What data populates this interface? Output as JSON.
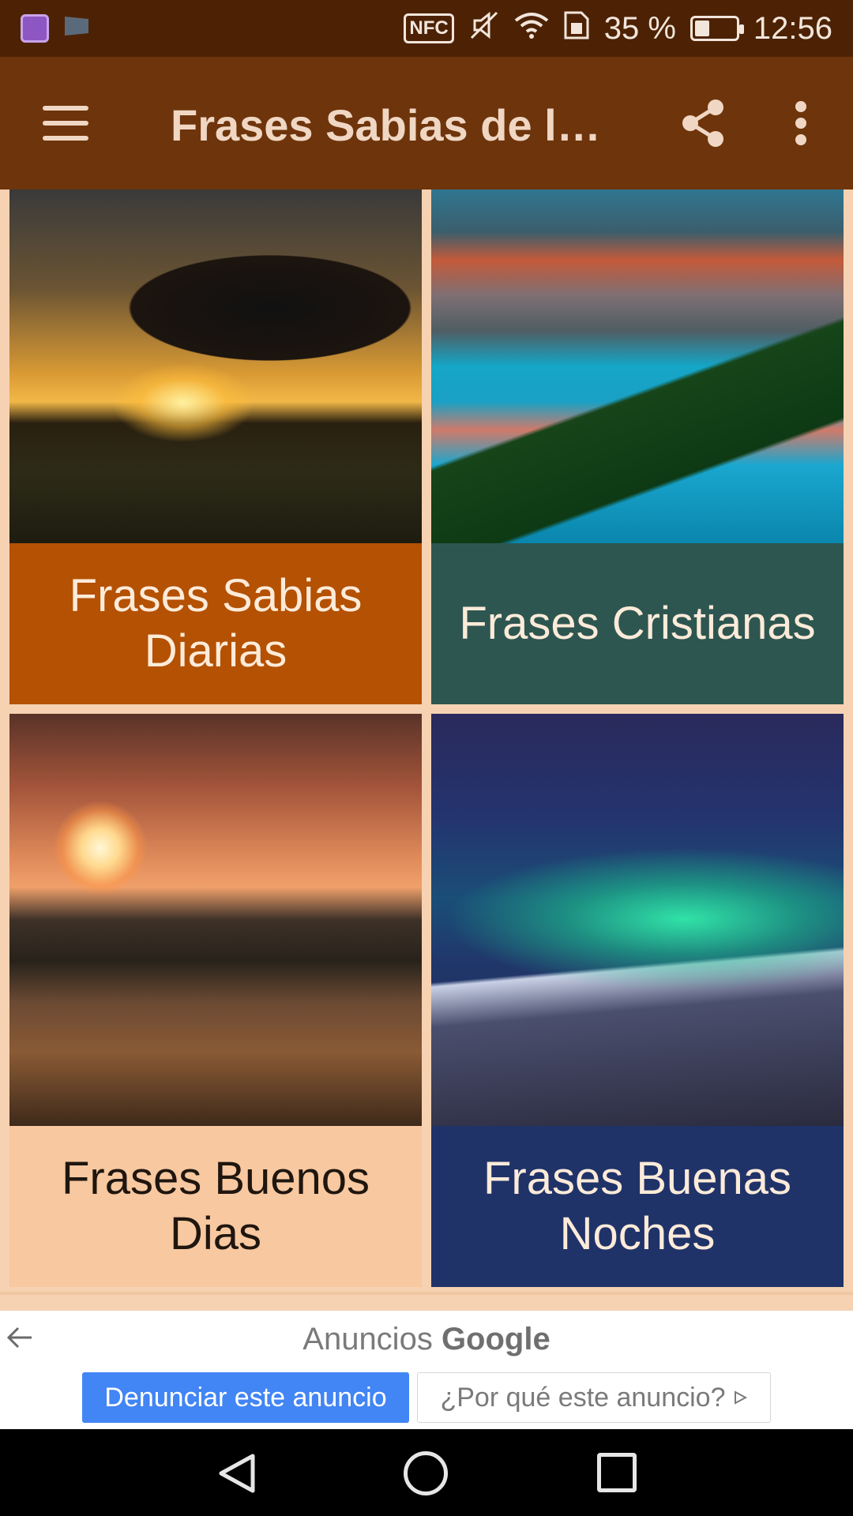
{
  "status_bar": {
    "nfc_label": "NFC",
    "battery_percent": "35 %",
    "battery_level": 0.35,
    "time": "12:56",
    "icons": [
      "app-notification-icon",
      "flag-notification-icon",
      "nfc-icon",
      "mute-icon",
      "wifi-icon",
      "sim-icon",
      "battery-icon"
    ]
  },
  "app_bar": {
    "title": "Frases Sabias de la…",
    "icons": [
      "menu-icon",
      "share-icon",
      "more-vert-icon"
    ]
  },
  "cards": [
    {
      "label": "Frases Sabias Diarias",
      "label_bg": "#b45103"
    },
    {
      "label": "Frases Cristianas",
      "label_bg": "#2e5651"
    },
    {
      "label": "Frases Buenos Dias",
      "label_bg": "#f8c8a0"
    },
    {
      "label": "Frases Buenas Noches",
      "label_bg": "#203369"
    }
  ],
  "ad": {
    "header_prefix": "Anuncios ",
    "header_brand": "Google",
    "report_button": "Denunciar este anuncio",
    "why_button": "¿Por qué este anuncio?",
    "accent": "#4285f4"
  },
  "nav_bar": {
    "icons": [
      "back-icon",
      "home-icon",
      "recents-icon"
    ]
  },
  "colors": {
    "status_bar": "#4d2204",
    "app_bar": "#6e340b",
    "background": "#f6d2b2"
  }
}
